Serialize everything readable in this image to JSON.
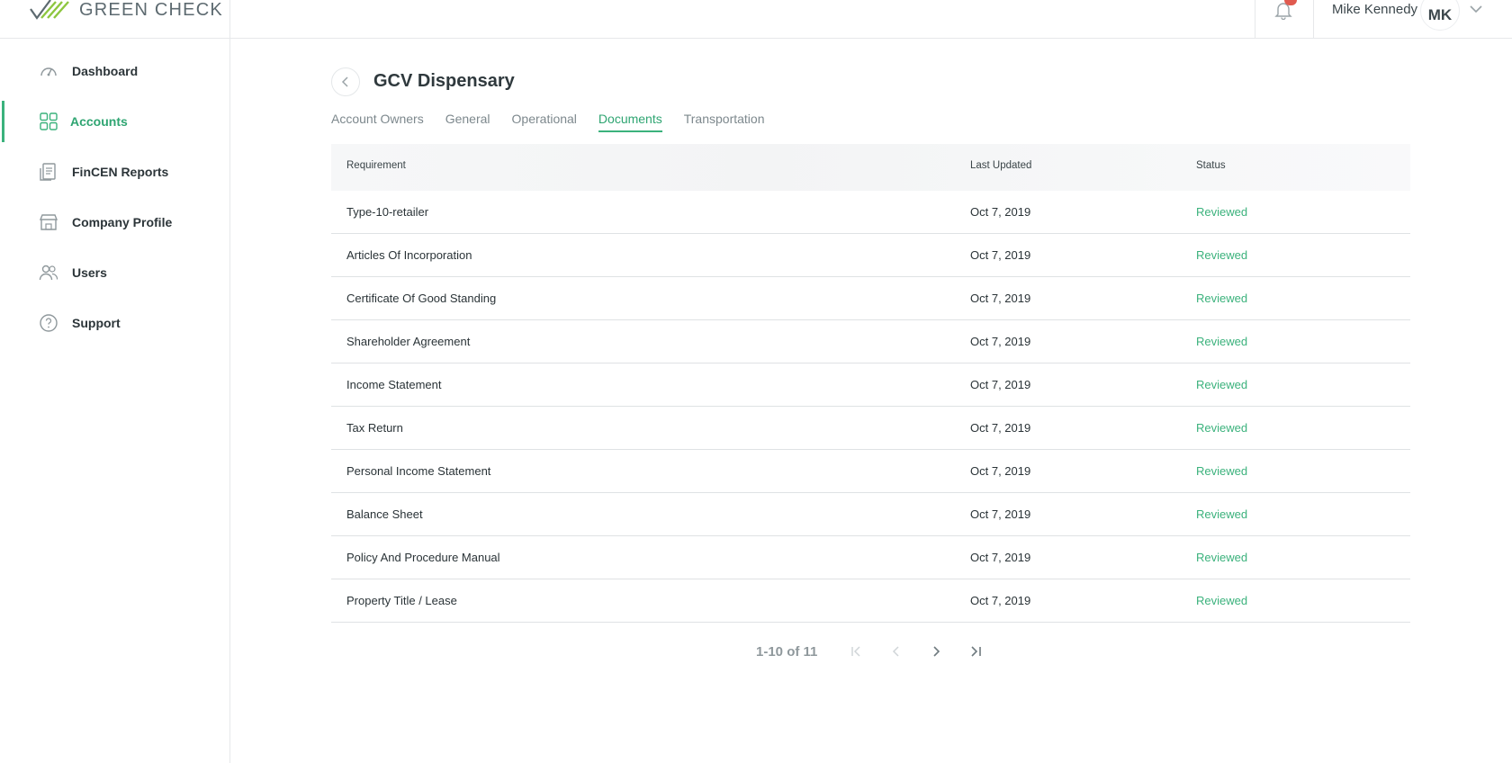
{
  "app": {
    "brand": "GREEN CHECK"
  },
  "header": {
    "user_name": "Mike Kennedy",
    "user_initials": "MK"
  },
  "sidebar": {
    "items": [
      {
        "label": "Dashboard",
        "icon": "dashboard-gauge-icon",
        "active": false
      },
      {
        "label": "Accounts",
        "icon": "grid-icon",
        "active": true
      },
      {
        "label": "FinCEN Reports",
        "icon": "report-document-icon",
        "active": false
      },
      {
        "label": "Company Profile",
        "icon": "storefront-icon",
        "active": false
      },
      {
        "label": "Users",
        "icon": "users-icon",
        "active": false
      },
      {
        "label": "Support",
        "icon": "help-circle-icon",
        "active": false
      }
    ]
  },
  "main": {
    "title": "GCV Dispensary",
    "tabs": [
      {
        "label": "Account Owners",
        "active": false
      },
      {
        "label": "General",
        "active": false
      },
      {
        "label": "Operational",
        "active": false
      },
      {
        "label": "Documents",
        "active": true
      },
      {
        "label": "Transportation",
        "active": false
      }
    ],
    "table": {
      "columns": [
        "Requirement",
        "Last Updated",
        "Status"
      ],
      "rows": [
        {
          "requirement": "Type-10-retailer",
          "last_updated": "Oct 7, 2019",
          "status": "Reviewed"
        },
        {
          "requirement": "Articles Of Incorporation",
          "last_updated": "Oct 7, 2019",
          "status": "Reviewed"
        },
        {
          "requirement": "Certificate Of Good Standing",
          "last_updated": "Oct 7, 2019",
          "status": "Reviewed"
        },
        {
          "requirement": "Shareholder Agreement",
          "last_updated": "Oct 7, 2019",
          "status": "Reviewed"
        },
        {
          "requirement": "Income Statement",
          "last_updated": "Oct 7, 2019",
          "status": "Reviewed"
        },
        {
          "requirement": "Tax Return",
          "last_updated": "Oct 7, 2019",
          "status": "Reviewed"
        },
        {
          "requirement": "Personal Income Statement",
          "last_updated": "Oct 7, 2019",
          "status": "Reviewed"
        },
        {
          "requirement": "Balance Sheet",
          "last_updated": "Oct 7, 2019",
          "status": "Reviewed"
        },
        {
          "requirement": "Policy And Procedure Manual",
          "last_updated": "Oct 7, 2019",
          "status": "Reviewed"
        },
        {
          "requirement": "Property Title / Lease",
          "last_updated": "Oct 7, 2019",
          "status": "Reviewed"
        }
      ]
    },
    "pagination": {
      "info": "1-10 of 11"
    }
  },
  "colors": {
    "accent": "#3bb27c",
    "notification_badge": "#e05a4f"
  }
}
